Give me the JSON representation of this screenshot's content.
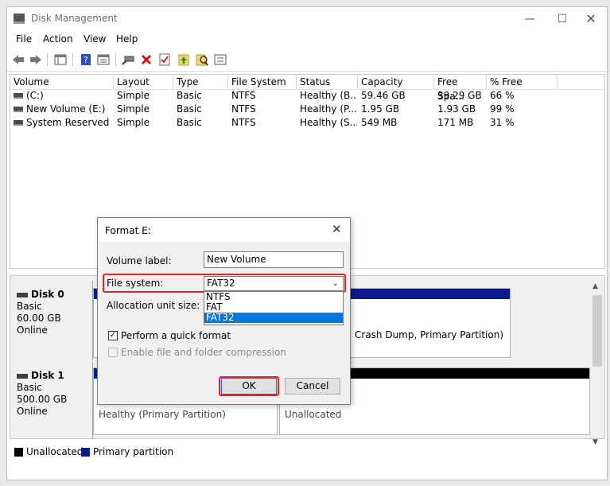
{
  "window": {
    "title": "Disk Management"
  },
  "menu": [
    "File",
    "Action",
    "View",
    "Help"
  ],
  "toolbar_icons": [
    "back-icon",
    "forward-icon",
    "console-tree-icon",
    "help-icon",
    "properties-icon",
    "connect-icon",
    "delete-icon",
    "check-icon",
    "refresh-icon",
    "search-icon",
    "list-icon"
  ],
  "volumes": {
    "columns": [
      "Volume",
      "Layout",
      "Type",
      "File System",
      "Status",
      "Capacity",
      "Free Spa...",
      "% Free"
    ],
    "rows": [
      [
        "(C:)",
        "Simple",
        "Basic",
        "NTFS",
        "Healthy (B...",
        "59.46 GB",
        "39.29 GB",
        "66 %"
      ],
      [
        "New Volume (E:)",
        "Simple",
        "Basic",
        "NTFS",
        "Healthy (P...",
        "1.95 GB",
        "1.93 GB",
        "99 %"
      ],
      [
        "System Reserved",
        "Simple",
        "Basic",
        "NTFS",
        "Healthy (S...",
        "549 MB",
        "171 MB",
        "31 %"
      ]
    ]
  },
  "disks": [
    {
      "name": "Disk 0",
      "type": "Basic",
      "size": "60.00 GB",
      "status": "Online",
      "partition_text": "Crash Dump, Primary Partition)"
    },
    {
      "name": "Disk 1",
      "type": "Basic",
      "size": "500.00 GB",
      "status": "Online",
      "partition_text": "Healthy (Primary Partition)",
      "unalloc_text": "Unallocated"
    }
  ],
  "legend": {
    "unallocated": "Unallocated",
    "primary": "Primary partition"
  },
  "colors": {
    "primary": "#0b1a8c",
    "unallocated": "#000000",
    "highlight": "#e0242b",
    "selection": "#0078d7"
  },
  "dialog": {
    "title": "Format E:",
    "volume_label_text": "Volume label:",
    "volume_label_value": "New Volume",
    "file_system_text": "File system:",
    "file_system_value": "FAT32",
    "file_system_options": [
      "NTFS",
      "FAT",
      "FAT32"
    ],
    "allocation_text": "Allocation unit size:",
    "quick_format_text": "Perform a quick format",
    "compression_text": "Enable file and folder compression",
    "ok_label": "OK",
    "cancel_label": "Cancel"
  }
}
